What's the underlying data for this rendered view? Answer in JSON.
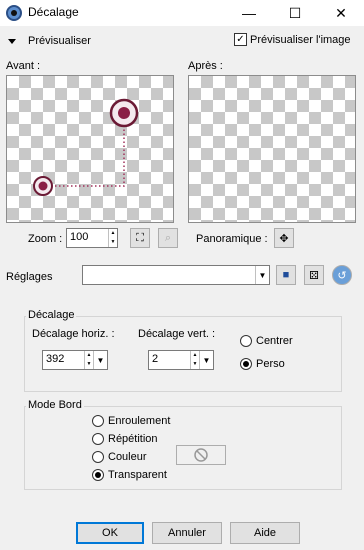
{
  "window": {
    "title": "Décalage",
    "minimize_glyph": "—",
    "maximize_glyph": "☐",
    "close_glyph": "✕"
  },
  "preview": {
    "toggle_label": "Prévisualiser",
    "preview_image_label": "Prévisualiser l'image",
    "preview_image_checked": true
  },
  "panels": {
    "before_label": "Avant :",
    "after_label": "Après :"
  },
  "zoom": {
    "label": "Zoom :",
    "value": "100",
    "pan_label": "Panoramique :"
  },
  "presets": {
    "label": "Réglages",
    "value": ""
  },
  "offset_group": {
    "title": "Décalage",
    "horiz_label": "Décalage horiz. :",
    "horiz_value": "392",
    "vert_label": "Décalage vert. :",
    "vert_value": "2",
    "center_label": "Centrer",
    "custom_label": "Perso",
    "selected": "Perso"
  },
  "edge_group": {
    "title": "Mode Bord",
    "options": [
      "Enroulement",
      "Répétition",
      "Couleur",
      "Transparent"
    ],
    "selected": "Transparent"
  },
  "buttons": {
    "ok": "OK",
    "cancel": "Annuler",
    "help": "Aide"
  },
  "colors": {
    "accent": "#0078d7",
    "marker": "#7a1c3c",
    "dotted_line": "#a0305a"
  }
}
